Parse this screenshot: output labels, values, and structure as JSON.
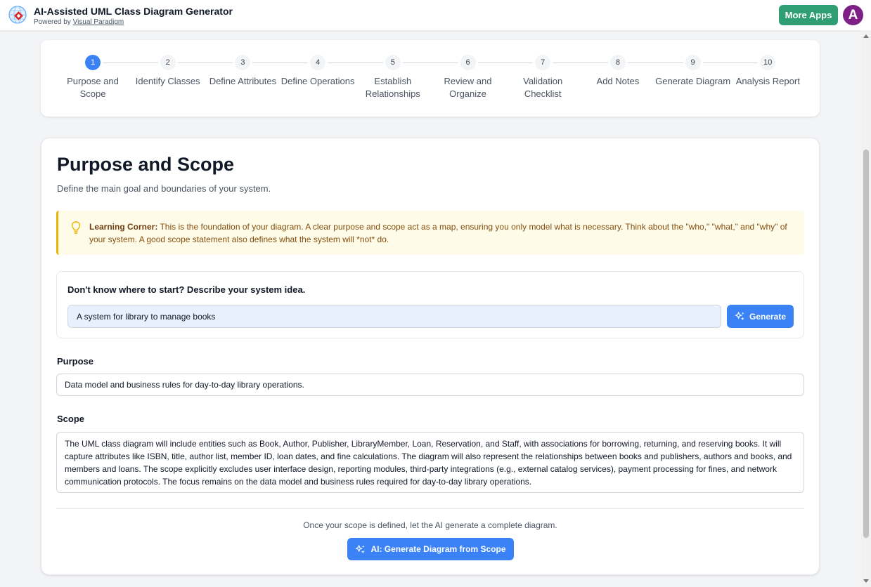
{
  "header": {
    "title": "AI-Assisted UML Class Diagram Generator",
    "powered_prefix": "Powered by",
    "powered_link": "Visual Paradigm",
    "more_apps": "More Apps",
    "avatar_letter": "A",
    "colors": {
      "more_apps": "#2f9e74",
      "avatar": "#7e1f86"
    }
  },
  "stepper": {
    "active_index": 0,
    "steps": [
      {
        "number": "1",
        "label": "Purpose and Scope"
      },
      {
        "number": "2",
        "label": "Identify Classes"
      },
      {
        "number": "3",
        "label": "Define Attributes"
      },
      {
        "number": "4",
        "label": "Define Operations"
      },
      {
        "number": "5",
        "label": "Establish Relationships"
      },
      {
        "number": "6",
        "label": "Review and Organize"
      },
      {
        "number": "7",
        "label": "Validation Checklist"
      },
      {
        "number": "8",
        "label": "Add Notes"
      },
      {
        "number": "9",
        "label": "Generate Diagram"
      },
      {
        "number": "10",
        "label": "Analysis Report"
      }
    ]
  },
  "main": {
    "title": "Purpose and Scope",
    "subtitle": "Define the main goal and boundaries of your system.",
    "learning": {
      "heading": "Learning Corner:",
      "text": " This is the foundation of your diagram. A clear purpose and scope act as a map, ensuring you only model what is necessary. Think about the \"who,\" \"what,\" and \"why\" of your system. A good scope statement also defines what the system will *not* do."
    },
    "idea": {
      "title": "Don't know where to start? Describe your system idea.",
      "input_value": "A system for library to manage books",
      "generate_label": "Generate"
    },
    "purpose": {
      "label": "Purpose",
      "value": "Data model and business rules for day-to-day library operations."
    },
    "scope": {
      "label": "Scope",
      "value": "The UML class diagram will include entities such as Book, Author, Publisher, LibraryMember, Loan, Reservation, and Staff, with associations for borrowing, returning, and reserving books. It will capture attributes like ISBN, title, author list, member ID, loan dates, and fine calculations. The diagram will also represent the relationships between books and publishers, authors and books, and members and loans. The scope explicitly excludes user interface design, reporting modules, third-party integrations (e.g., external catalog services), payment processing for fines, and network communication protocols. The focus remains on the data model and business rules required for day-to-day library operations."
    },
    "footer_note": "Once your scope is defined, let the AI generate a complete diagram.",
    "ai_button": "AI: Generate Diagram from Scope",
    "colors": {
      "primary": "#3b82f6",
      "learning_bg": "#fefce8",
      "learning_border": "#eab308"
    }
  }
}
